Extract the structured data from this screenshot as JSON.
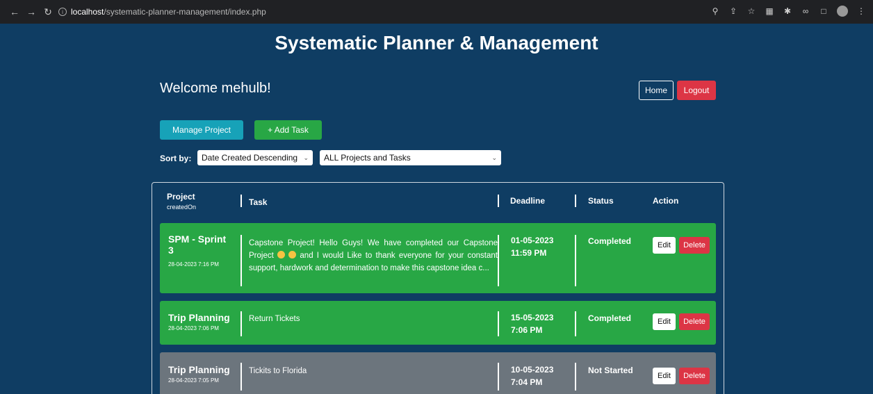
{
  "browser": {
    "url_host": "localhost",
    "url_path": "/systematic-planner-management/index.php"
  },
  "page": {
    "title": "Systematic Planner & Management",
    "welcome": "Welcome mehulb!",
    "home_label": "Home",
    "logout_label": "Logout",
    "manage_label": "Manage Project",
    "add_task_label": "+ Add Task",
    "sort_label": "Sort by:",
    "sort_value": "Date Created Descending",
    "filter_value": "ALL Projects and Tasks"
  },
  "table": {
    "headers": {
      "project": "Project",
      "created_on": "createdOn",
      "task": "Task",
      "deadline": "Deadline",
      "status": "Status",
      "action": "Action"
    },
    "rows": [
      {
        "project_line1": "SPM - Sprint",
        "project_line2": "3",
        "created": "28-04-2023 7:16 PM",
        "task_a": "Capstone Project! Hello Guys! We have completed our Capstone Project ",
        "task_b": " and I would Like to thank everyone for your constant support, hardwork and determination to make this capstone idea c...",
        "deadline_date": "01-05-2023",
        "deadline_time": "11:59 PM",
        "status": "Completed",
        "edit": "Edit",
        "delete": "Delete"
      },
      {
        "project_line1": "Trip Planning",
        "created": "28-04-2023 7:06 PM",
        "task": "Return Tickets",
        "deadline_date": "15-05-2023",
        "deadline_time": "7:06 PM",
        "status": "Completed",
        "edit": "Edit",
        "delete": "Delete"
      },
      {
        "project_line1": "Trip Planning",
        "created": "28-04-2023 7:05 PM",
        "task": "Tickits to Florida",
        "deadline_date": "10-05-2023",
        "deadline_time": "7:04 PM",
        "status": "Not Started",
        "edit": "Edit",
        "delete": "Delete"
      }
    ]
  },
  "colors": {
    "background": "#0f3d63",
    "completed": "#28a745",
    "not_started": "#6c757d",
    "danger": "#dc3545",
    "info": "#17a2b8"
  }
}
